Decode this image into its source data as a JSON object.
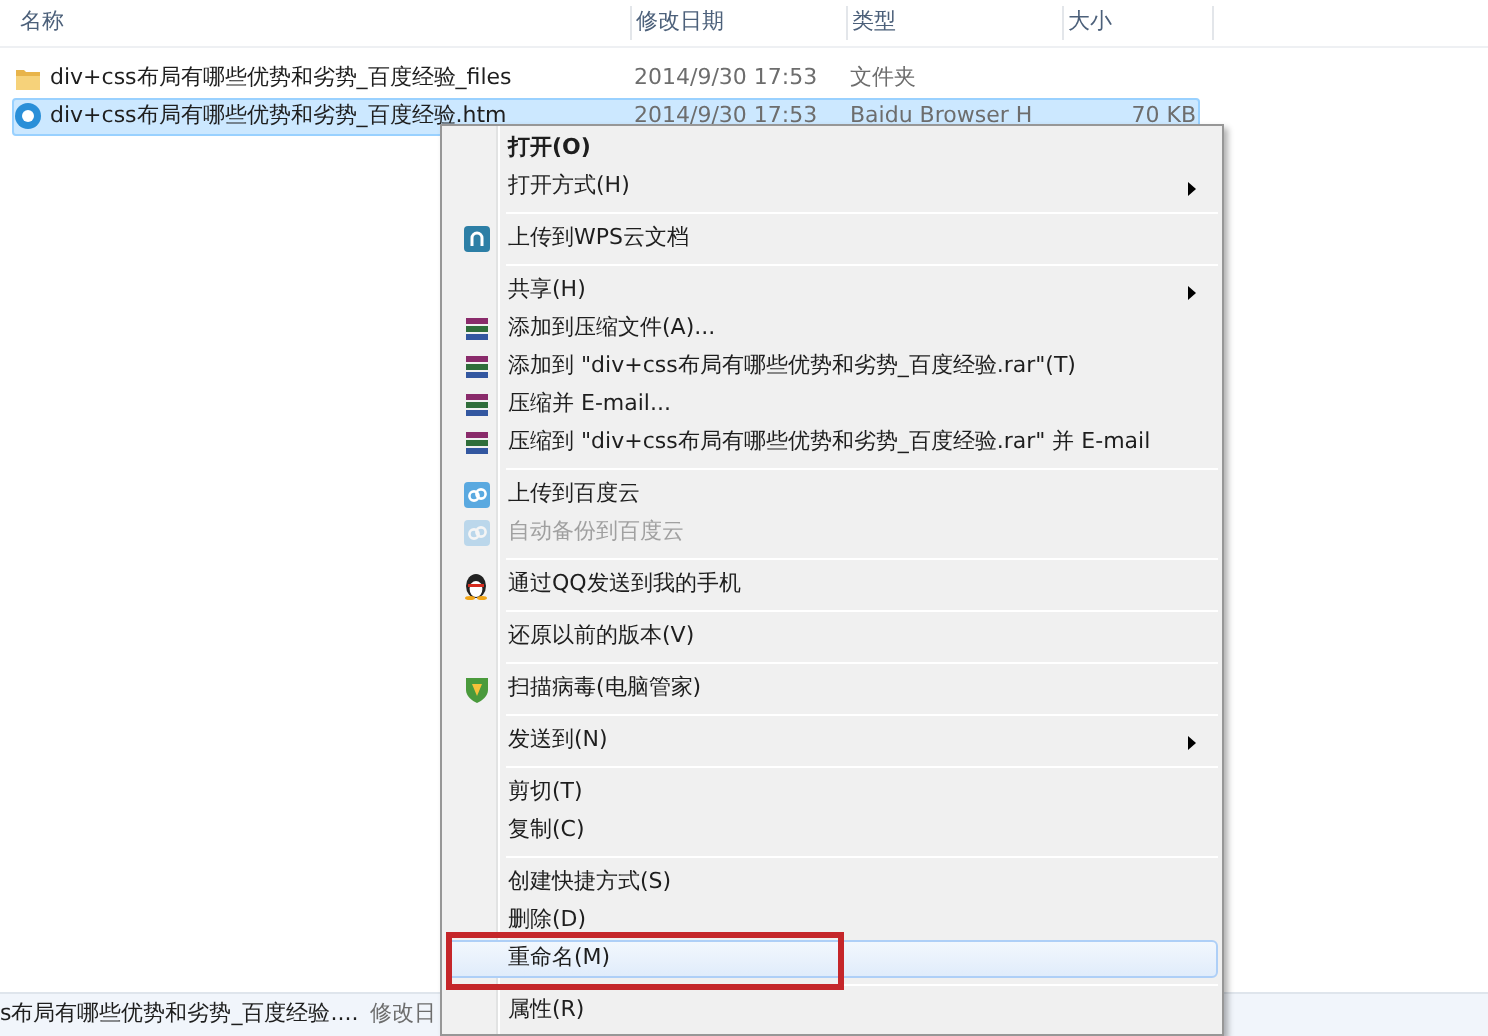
{
  "columns": [
    {
      "label": "名称"
    },
    {
      "label": "修改日期"
    },
    {
      "label": "类型"
    },
    {
      "label": "大小"
    }
  ],
  "files": [
    {
      "kind": "folder",
      "name": "div+css布局有哪些优势和劣势_百度经验_files",
      "date": "2014/9/30 17:53",
      "type": "文件夹",
      "selected": false
    },
    {
      "kind": "webpage",
      "name": "div+css布局有哪些优势和劣势_百度经验.htm",
      "date": "2014/9/30 17:53",
      "type": "Baidu Browser H",
      "size": "70 KB",
      "selected": true
    }
  ],
  "context_menu": [
    {
      "kind": "plain",
      "label": "打开(O)",
      "bold": true,
      "submenu": false,
      "disabled": false,
      "selected": false,
      "annotated": false
    },
    {
      "kind": "plain",
      "label": "打开方式(H)",
      "bold": false,
      "submenu": true,
      "disabled": false,
      "selected": false,
      "annotated": false
    },
    {
      "kind": "separator"
    },
    {
      "kind": "upload",
      "label": "上传到WPS云文档",
      "bold": false,
      "submenu": false,
      "disabled": false,
      "selected": false,
      "annotated": false
    },
    {
      "kind": "separator"
    },
    {
      "kind": "plain",
      "label": "共享(H)",
      "bold": false,
      "submenu": true,
      "disabled": false,
      "selected": false,
      "annotated": false
    },
    {
      "kind": "archive",
      "label": "添加到压缩文件(A)...",
      "bold": false,
      "submenu": false,
      "disabled": false,
      "selected": false,
      "annotated": false
    },
    {
      "kind": "archive",
      "label": "添加到 \"div+css布局有哪些优势和劣势_百度经验.rar\"(T)",
      "bold": false,
      "submenu": false,
      "disabled": false,
      "selected": false,
      "annotated": false
    },
    {
      "kind": "archive",
      "label": "压缩并 E-mail...",
      "bold": false,
      "submenu": false,
      "disabled": false,
      "selected": false,
      "annotated": false
    },
    {
      "kind": "archive",
      "label": "压缩到 \"div+css布局有哪些优势和劣势_百度经验.rar\" 并 E-mail",
      "bold": false,
      "submenu": false,
      "disabled": false,
      "selected": false,
      "annotated": false
    },
    {
      "kind": "separator"
    },
    {
      "kind": "cloud",
      "label": "上传到百度云",
      "bold": false,
      "submenu": false,
      "disabled": false,
      "selected": false,
      "annotated": false
    },
    {
      "kind": "cloud",
      "label": "自动备份到百度云",
      "bold": false,
      "submenu": false,
      "disabled": true,
      "selected": false,
      "annotated": false
    },
    {
      "kind": "separator"
    },
    {
      "kind": "messenger",
      "label": "通过QQ发送到我的手机",
      "bold": false,
      "submenu": false,
      "disabled": false,
      "selected": false,
      "annotated": false
    },
    {
      "kind": "separator"
    },
    {
      "kind": "plain",
      "label": "还原以前的版本(V)",
      "bold": false,
      "submenu": false,
      "disabled": false,
      "selected": false,
      "annotated": false
    },
    {
      "kind": "separator"
    },
    {
      "kind": "antivirus",
      "label": "扫描病毒(电脑管家)",
      "bold": false,
      "submenu": false,
      "disabled": false,
      "selected": false,
      "annotated": false
    },
    {
      "kind": "separator"
    },
    {
      "kind": "plain",
      "label": "发送到(N)",
      "bold": false,
      "submenu": true,
      "disabled": false,
      "selected": false,
      "annotated": false
    },
    {
      "kind": "separator"
    },
    {
      "kind": "plain",
      "label": "剪切(T)",
      "bold": false,
      "submenu": false,
      "disabled": false,
      "selected": false,
      "annotated": false
    },
    {
      "kind": "plain",
      "label": "复制(C)",
      "bold": false,
      "submenu": false,
      "disabled": false,
      "selected": false,
      "annotated": false
    },
    {
      "kind": "separator"
    },
    {
      "kind": "plain",
      "label": "创建快捷方式(S)",
      "bold": false,
      "submenu": false,
      "disabled": false,
      "selected": false,
      "annotated": false
    },
    {
      "kind": "plain",
      "label": "删除(D)",
      "bold": false,
      "submenu": false,
      "disabled": false,
      "selected": false,
      "annotated": false
    },
    {
      "kind": "plain",
      "label": "重命名(M)",
      "bold": false,
      "submenu": false,
      "disabled": false,
      "selected": true,
      "annotated": true
    },
    {
      "kind": "separator"
    },
    {
      "kind": "plain",
      "label": "属性(R)",
      "bold": false,
      "submenu": false,
      "disabled": false,
      "selected": false,
      "annotated": false
    }
  ],
  "status_bar": {
    "name": "s布局有哪些优势和劣势_百度经验....",
    "label": "修改日"
  }
}
